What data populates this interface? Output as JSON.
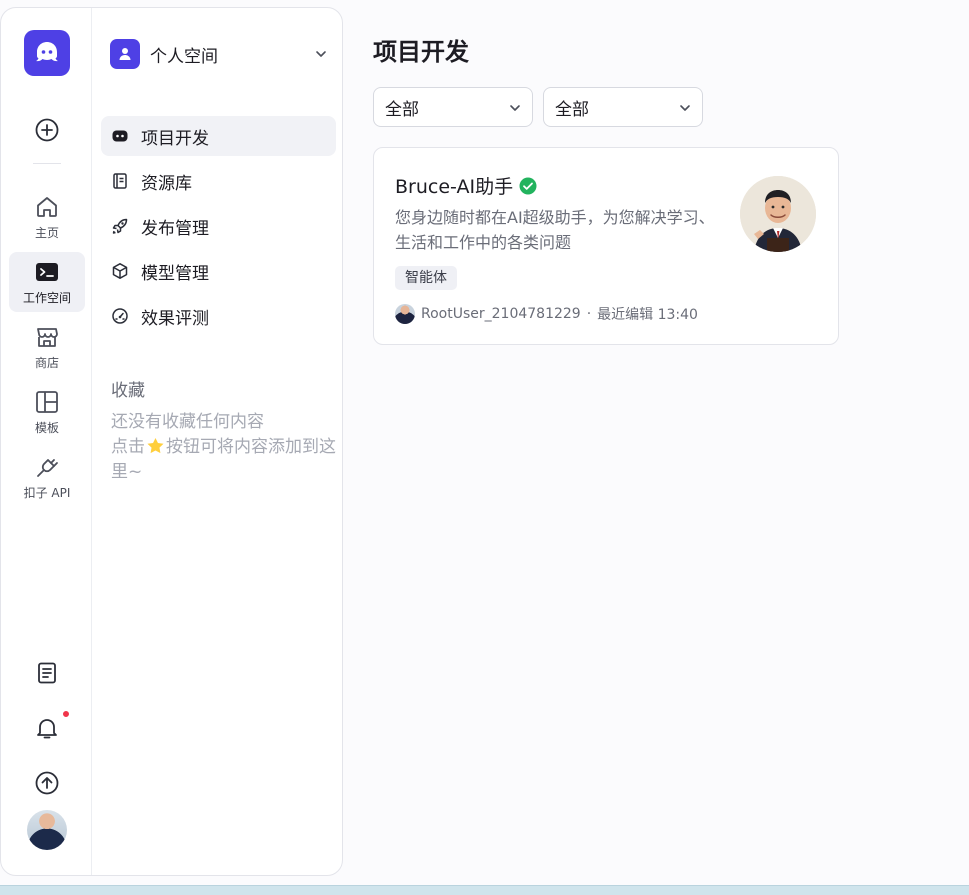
{
  "rail": {
    "items": [
      {
        "label": "主页",
        "icon": "home-icon"
      },
      {
        "label": "工作空间",
        "icon": "terminal-icon"
      },
      {
        "label": "商店",
        "icon": "store-icon"
      },
      {
        "label": "模板",
        "icon": "template-icon"
      },
      {
        "label": "扣子 API",
        "icon": "plug-icon"
      }
    ],
    "bottom_icons": [
      "document-icon",
      "bell-icon",
      "upload-icon"
    ]
  },
  "space": {
    "name": "个人空间"
  },
  "nav": {
    "items": [
      {
        "label": "项目开发",
        "icon": "bot-icon"
      },
      {
        "label": "资源库",
        "icon": "library-icon"
      },
      {
        "label": "发布管理",
        "icon": "rocket-icon"
      },
      {
        "label": "模型管理",
        "icon": "cube-icon"
      },
      {
        "label": "效果评测",
        "icon": "gauge-icon"
      }
    ],
    "favorites_title": "收藏",
    "favorites_empty_1": "还没有收藏任何内容",
    "favorites_empty_2": "点击",
    "favorites_empty_3": "按钮可将内容添加到这里~"
  },
  "main": {
    "title": "项目开发",
    "filters": [
      "全部",
      "全部"
    ],
    "card": {
      "title": "Bruce-AI助手",
      "description": "您身边随时都在AI超级助手，为您解决学习、生活和工作中的各类问题",
      "tag": "智能体",
      "owner": "RootUser_2104781229",
      "separator": "·",
      "edited": "最近编辑 13:40"
    }
  },
  "colors": {
    "brand": "#4e40e5",
    "verified": "#22b35e",
    "notification": "#f0354a"
  }
}
